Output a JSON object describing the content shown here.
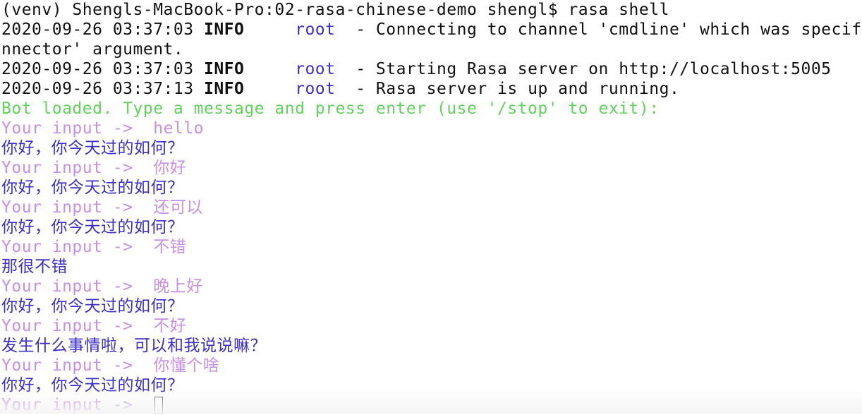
{
  "command_line": "(venv) Shengls-MacBook-Pro:02-rasa-chinese-demo shengl$ rasa shell",
  "log_lines": [
    {
      "timestamp": "2020-09-26 03:37:03",
      "level": "INFO",
      "logger": "root",
      "message": "  - Connecting to channel 'cmdline' which was specifie"
    },
    {
      "timestamp": "2020-09-26 03:37:03",
      "level": "INFO",
      "logger": "root",
      "message": "  - Starting Rasa server on http://localhost:5005"
    },
    {
      "timestamp": "2020-09-26 03:37:13",
      "level": "INFO",
      "logger": "root",
      "message": "  - Rasa server is up and running."
    }
  ],
  "log_wrap_continuation": "nnector' argument.",
  "bot_loaded_text": "Bot loaded. Type a message and press enter (use '/stop' to exit):",
  "prompt_label": "Your input ->  ",
  "conversation": [
    {
      "user": "hello",
      "bot": "你好，你今天过的如何？"
    },
    {
      "user": "你好",
      "bot": "你好，你今天过的如何？"
    },
    {
      "user": "还可以",
      "bot": "你好，你今天过的如何？"
    },
    {
      "user": "不错",
      "bot": "那很不错"
    },
    {
      "user": "晚上好",
      "bot": "你好，你今天过的如何？"
    },
    {
      "user": "不好",
      "bot": "发生什么事情啦，可以和我说说嘛？"
    },
    {
      "user": "你懂个啥",
      "bot": "你好，你今天过的如何？"
    }
  ],
  "colors": {
    "prompt": "#c790e6",
    "bot_reply": "#3b2fc9",
    "bot_loaded": "#5fd35a",
    "logger": "#3b2fc9"
  }
}
